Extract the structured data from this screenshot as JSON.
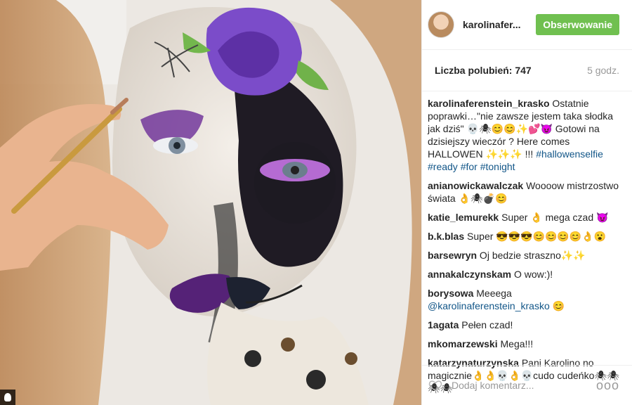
{
  "post": {
    "username": "karolinafer...",
    "follow_label": "Obserwowanie",
    "likes": "Liczba polubień: 747",
    "time_ago": "5 godz.",
    "comments": [
      {
        "user": "karolinaferenstein_krasko",
        "text": " Ostatnie poprawki…\"nie zawsze jestem taka słodka jak dziś\" 💀🕷😊😊✨💕😈 Gotowi na dzisiejszy wieczór ? Here comes HALLOWEN ✨✨✨ !!! ",
        "tags": "#hallowenselfie #ready #for #tonight"
      },
      {
        "user": "anianowickawalczak",
        "text": " Woooow mistrzostwo świata 👌🕷💣😊"
      },
      {
        "user": "katie_lemurekk",
        "text": " Super 👌 mega czad 😈"
      },
      {
        "user": "b.k.blas",
        "text": " Super 😎😎😎😊😊😊😊👌😮"
      },
      {
        "user": "barsewryn",
        "text": " Oj bedzie straszno✨✨"
      },
      {
        "user": "annakalczynskam",
        "text": " O wow:)!"
      },
      {
        "user": "borysowa",
        "text": " Meeega ",
        "tags": "@karolinaferenstein_krasko",
        "text2": " 😊"
      },
      {
        "user": "1agata",
        "text": " Pełen czad!"
      },
      {
        "user": "mkomarzewski",
        "text": " Mega!!!"
      },
      {
        "user": "katarzynaturzynska",
        "text": " Pani Karolino no magicznie👌👌💀👌💀cudo cudeńko🕷🕷🕷🕷"
      }
    ],
    "add_comment_placeholder": "Dodaj komentarz...",
    "more_label": "ooo"
  },
  "photo_icon": "person-tag-icon",
  "colors": {
    "follow": "#70c050",
    "link": "#125688"
  }
}
